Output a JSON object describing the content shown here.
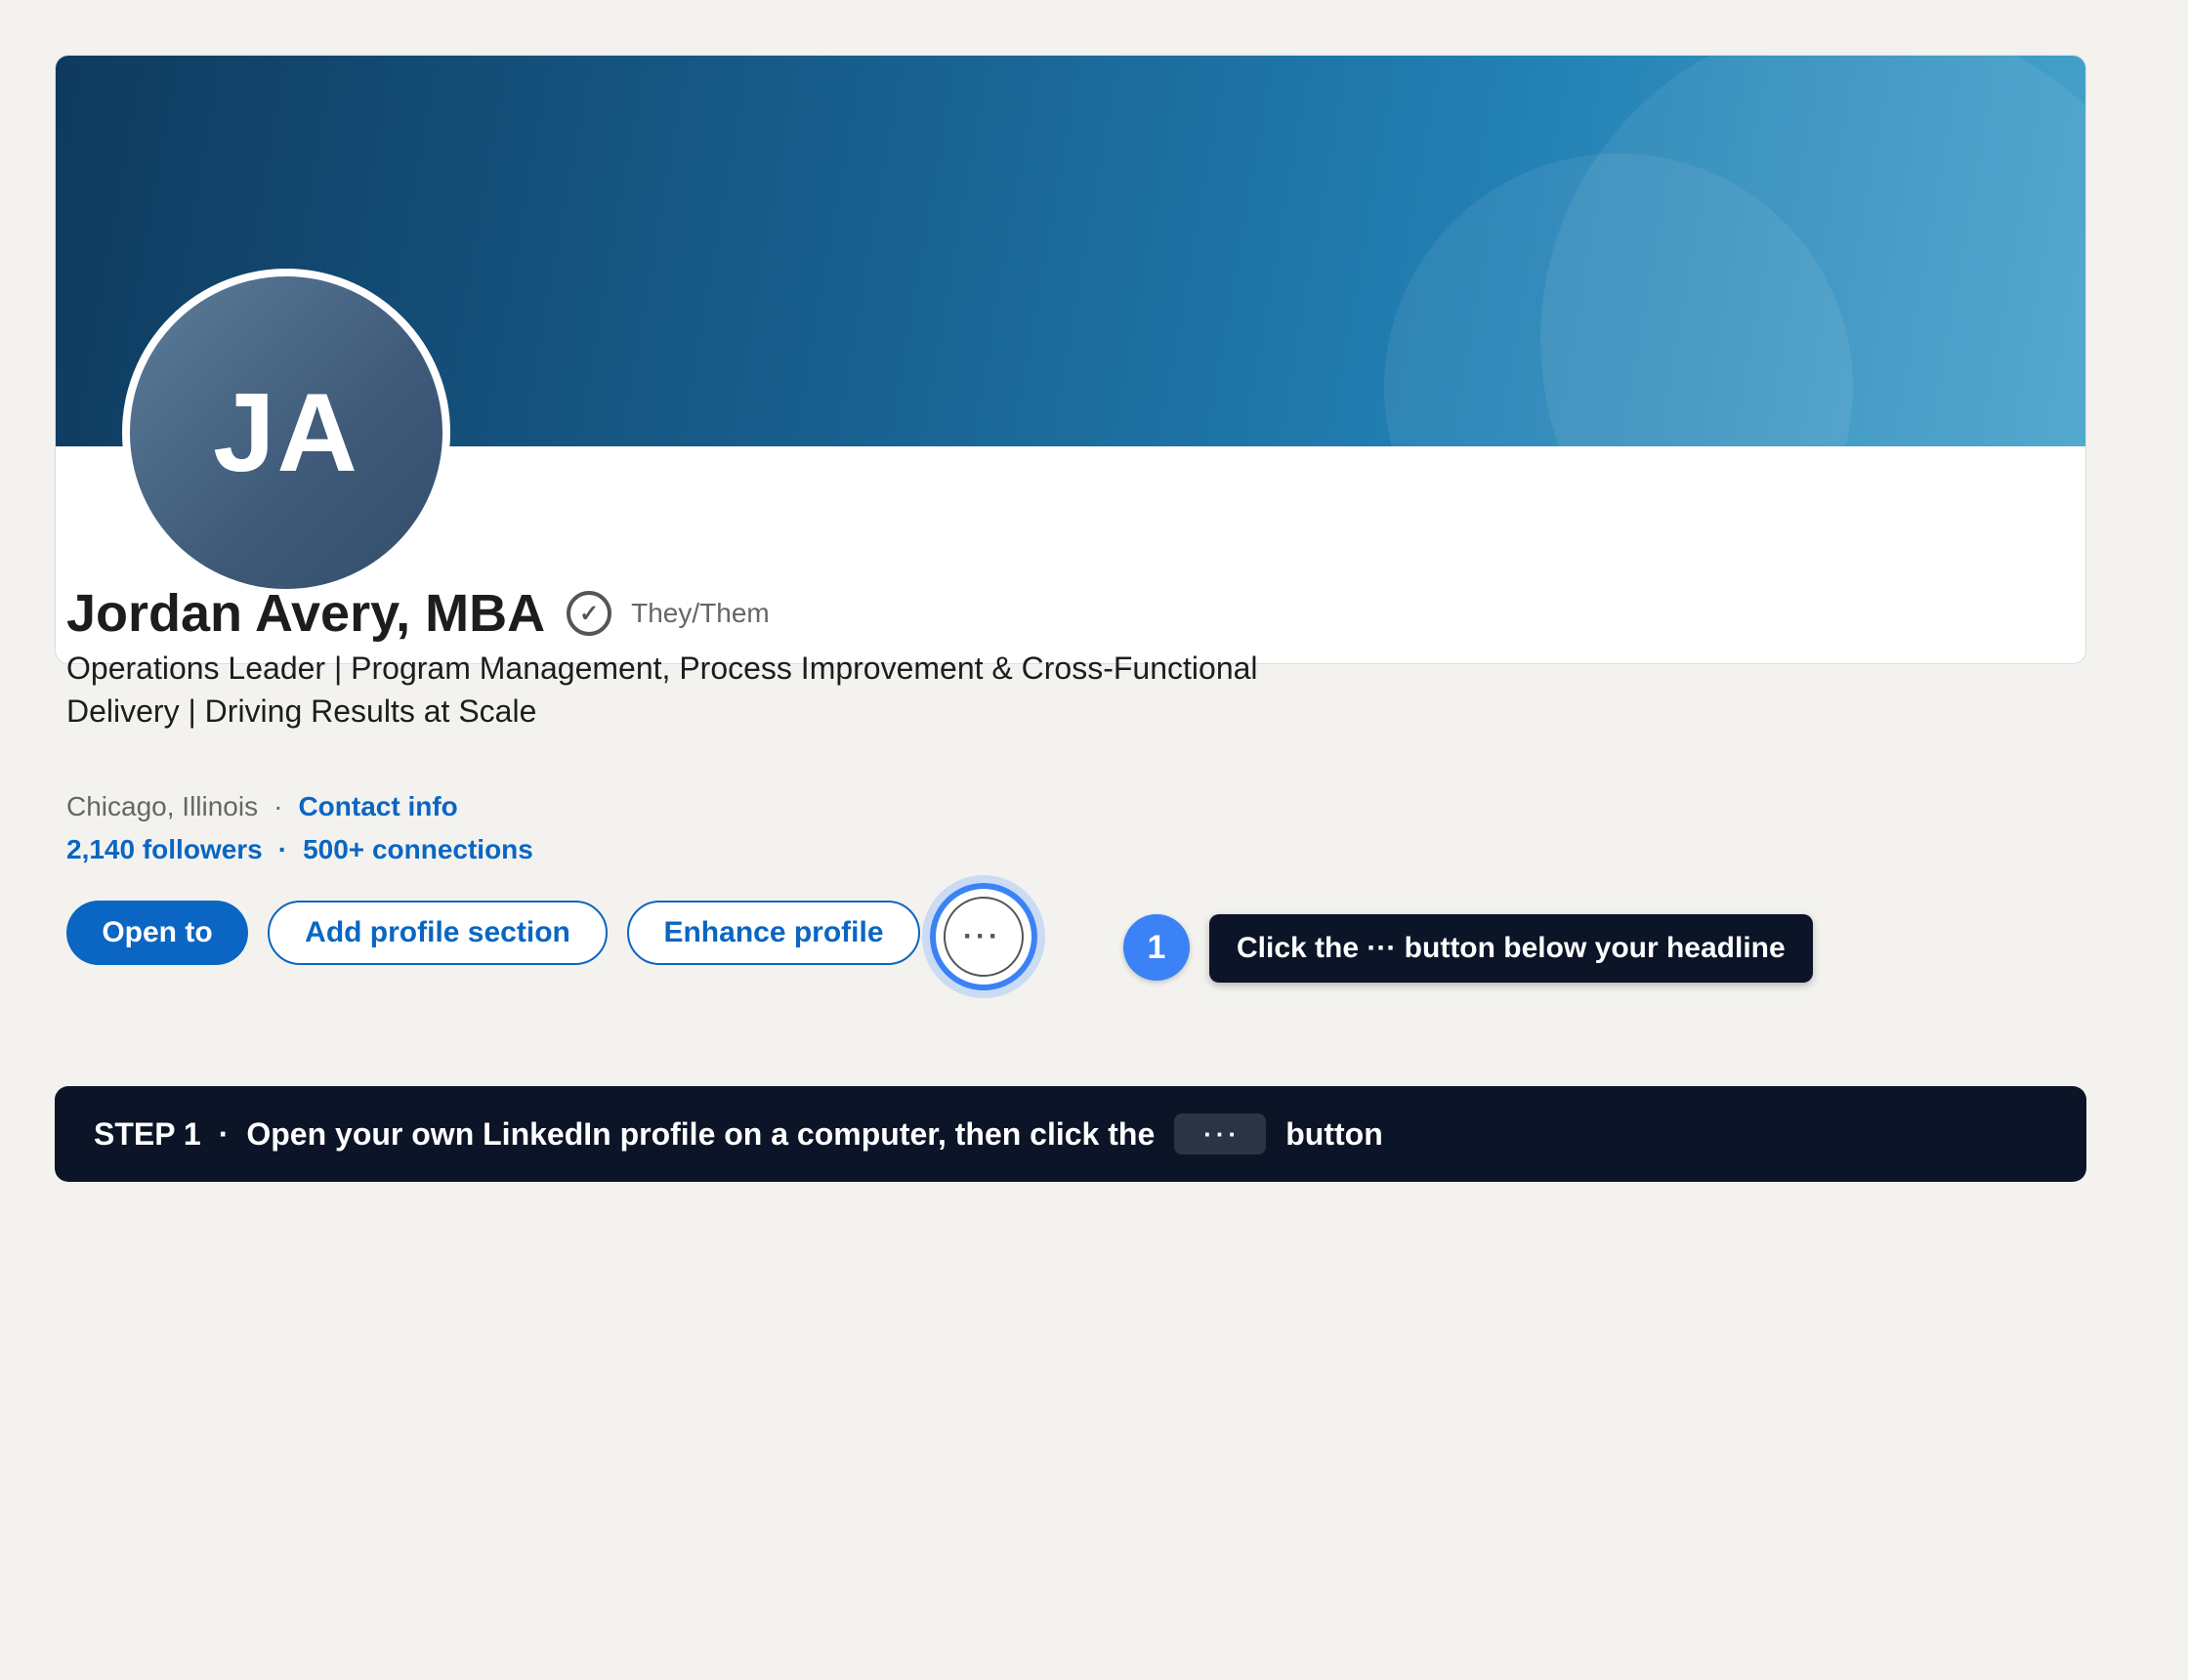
{
  "profile": {
    "initials": "JA",
    "name": "Jordan Avery, MBA",
    "verified_symbol": "✓",
    "pronouns": "They/Them",
    "headline": "Operations Leader | Program Management, Process Improvement & Cross-Functional Delivery | Driving Results at Scale",
    "location": "Chicago, Illinois",
    "separator": "·",
    "contact_info": "Contact info",
    "followers": "2,140 followers",
    "connections": "500+ connections"
  },
  "actions": {
    "open_to": "Open to",
    "add_section": "Add profile section",
    "enhance": "Enhance profile",
    "more": "···"
  },
  "callout": {
    "step_number": "1",
    "tooltip": "Click the ··· button below your headline"
  },
  "step_bar": {
    "label": "STEP 1",
    "separator": "·",
    "text": "Open your own LinkedIn profile on a computer, then click the",
    "key": "···",
    "suffix": "button"
  },
  "colors": {
    "accent": "#0a66c2",
    "highlight": "#3b82f6",
    "dark": "#0b1527",
    "background": "#f3f2ef"
  },
  "icons": {
    "verified": "verified-check-icon",
    "more": "more-horizontal-icon"
  }
}
